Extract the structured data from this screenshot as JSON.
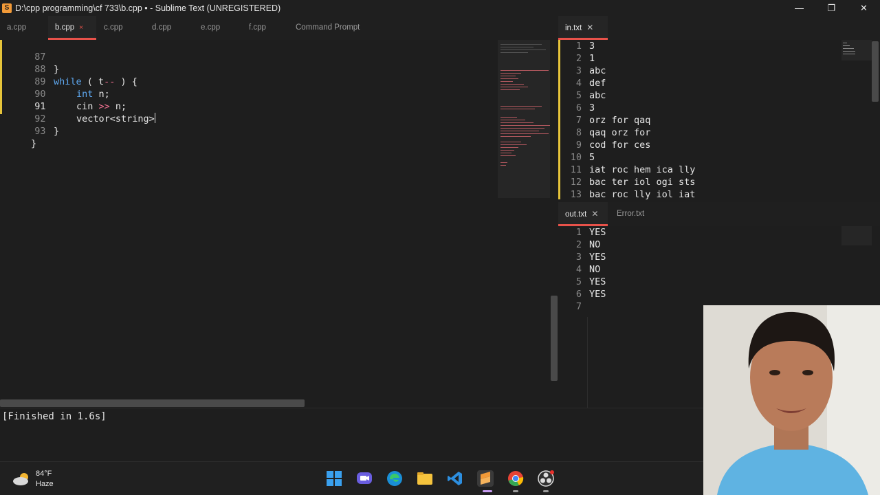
{
  "window": {
    "title": "D:\\cpp programming\\cf 733\\b.cpp • - Sublime Text (UNREGISTERED)",
    "app_icon_letter": "S",
    "minimize_glyph": "—",
    "maximize_glyph": "❐",
    "close_glyph": "✕"
  },
  "editor_tabs": [
    {
      "label": "a.cpp"
    },
    {
      "label": "b.cpp",
      "marker": "×"
    },
    {
      "label": "c.cpp"
    },
    {
      "label": "d.cpp"
    },
    {
      "label": "e.cpp"
    },
    {
      "label": "f.cpp"
    },
    {
      "label": "Command Prompt"
    }
  ],
  "code": {
    "line_numbers": [
      "87",
      "88",
      "89",
      "90",
      "91",
      "92",
      "93"
    ],
    "current_line": "91",
    "l87": {
      "t": "}"
    },
    "l88": {
      "kw": "while",
      "a": " ( t",
      "op": "--",
      "b": " ) {"
    },
    "l89": {
      "kw": "int",
      "a": " n;"
    },
    "l90": {
      "a": "cin ",
      "op": ">>",
      "b": " n;"
    },
    "l91": {
      "a": "vector<string>"
    },
    "l92": {
      "t": "}"
    },
    "l93": {
      "t": "}"
    }
  },
  "input_tab": {
    "label": "in.txt",
    "close": "✕"
  },
  "input_lines": [
    {
      "n": "1",
      "text": "3"
    },
    {
      "n": "2",
      "text": "1"
    },
    {
      "n": "3",
      "text": "abc"
    },
    {
      "n": "4",
      "text": "def"
    },
    {
      "n": "5",
      "text": "abc"
    },
    {
      "n": "6",
      "text": "3"
    },
    {
      "n": "7",
      "text": "orz for qaq"
    },
    {
      "n": "8",
      "text": "qaq orz for"
    },
    {
      "n": "9",
      "text": "cod for ces"
    },
    {
      "n": "10",
      "text": "5"
    },
    {
      "n": "11",
      "text": "iat roc hem ica lly"
    },
    {
      "n": "12",
      "text": "bac ter iol ogi sts"
    },
    {
      "n": "13",
      "text": "bac roc lly iol iat"
    }
  ],
  "output_tabs": [
    {
      "label": "out.txt",
      "close": "✕"
    },
    {
      "label": "Error.txt"
    }
  ],
  "output_lines": [
    {
      "n": "1",
      "text": "YES"
    },
    {
      "n": "2",
      "text": "NO"
    },
    {
      "n": "3",
      "text": "YES"
    },
    {
      "n": "4",
      "text": "NO"
    },
    {
      "n": "5",
      "text": "YES"
    },
    {
      "n": "6",
      "text": "YES"
    },
    {
      "n": "7",
      "text": ""
    }
  ],
  "console": {
    "text": "[Finished in 1.6s]"
  },
  "taskbar": {
    "weather_temp": "84°F",
    "weather_desc": "Haze",
    "apps": [
      "windows-start",
      "teams-chat",
      "edge",
      "file-explorer",
      "vscode",
      "sublime-text",
      "chrome",
      "obs"
    ]
  },
  "colors": {
    "accent_tab": "#e8524a",
    "keyword": "#5ea8f0",
    "operator": "#ef6f8f",
    "modified_gutter": "#e6c43a"
  }
}
